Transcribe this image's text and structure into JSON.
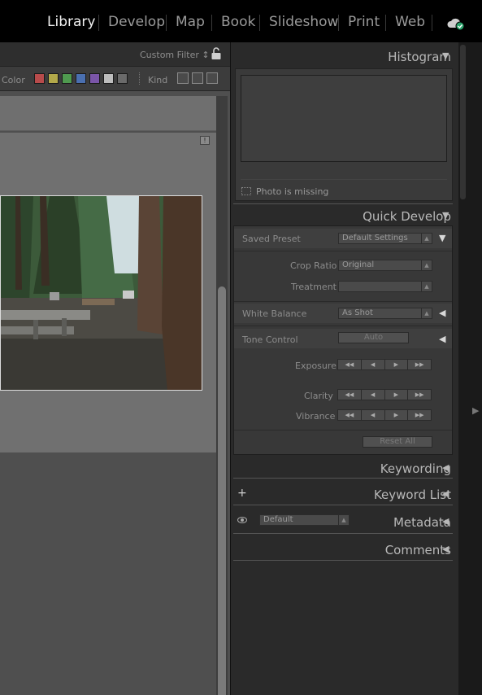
{
  "modules": [
    {
      "label": "Library",
      "active": true
    },
    {
      "label": "Develop",
      "active": false
    },
    {
      "label": "Map",
      "active": false
    },
    {
      "label": "Book",
      "active": false
    },
    {
      "label": "Slideshow",
      "active": false
    },
    {
      "label": "Print",
      "active": false
    },
    {
      "label": "Web",
      "active": false
    }
  ],
  "filter": {
    "custom_filter": "Custom Filter ↕",
    "color_label": "Color",
    "kind_label": "Kind",
    "swatches": [
      "#b84b4b",
      "#b3a94a",
      "#4f9a4f",
      "#4a6fb0",
      "#7a55a8",
      "#bdbdbd",
      "#6a6a6a"
    ]
  },
  "grid": {
    "badge": "!"
  },
  "panels": {
    "histogram": {
      "title": "Histogram",
      "photo_missing": "Photo is missing"
    },
    "quick_develop": {
      "title": "Quick Develop",
      "saved_preset_label": "Saved Preset",
      "saved_preset_value": "Default Settings",
      "crop_ratio_label": "Crop Ratio",
      "crop_ratio_value": "Original",
      "treatment_label": "Treatment",
      "treatment_value": "",
      "white_balance_label": "White Balance",
      "white_balance_value": "As Shot",
      "tone_control_label": "Tone Control",
      "auto_button": "Auto",
      "exposure_label": "Exposure",
      "clarity_label": "Clarity",
      "vibrance_label": "Vibrance",
      "reset_all": "Reset All"
    },
    "keywording": {
      "title": "Keywording"
    },
    "keyword_list": {
      "title": "Keyword List"
    },
    "metadata": {
      "title": "Metadata",
      "preset": "Default"
    },
    "comments": {
      "title": "Comments"
    }
  }
}
